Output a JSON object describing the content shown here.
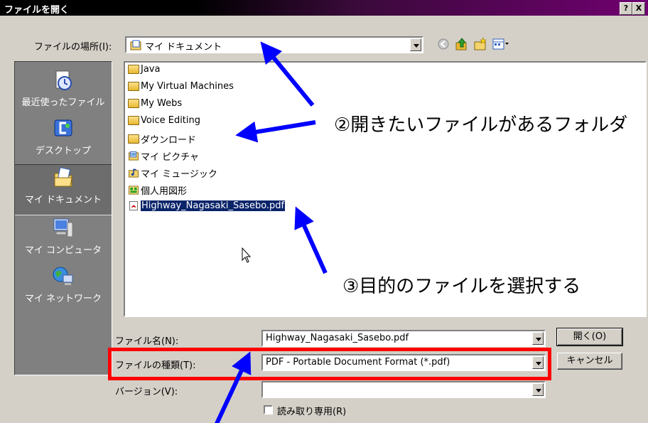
{
  "window": {
    "title": "ファイルを開く",
    "help_label": "?",
    "close_label": "X"
  },
  "lookin": {
    "label": "ファイルの場所(I):",
    "value": "マイ ドキュメント"
  },
  "toolbar_icons": [
    "back-icon",
    "up-folder-icon",
    "new-folder-icon",
    "view-menu-icon"
  ],
  "places": [
    {
      "label": "最近使ったファイル",
      "icon": "recent-files-icon"
    },
    {
      "label": "デスクトップ",
      "icon": "desktop-icon"
    },
    {
      "label": "マイ ドキュメント",
      "icon": "my-documents-icon",
      "selected": true
    },
    {
      "label": "マイ コンピュータ",
      "icon": "my-computer-icon"
    },
    {
      "label": "マイ ネットワーク",
      "icon": "my-network-icon"
    }
  ],
  "files": [
    {
      "name": "Java",
      "type": "folder"
    },
    {
      "name": "My Virtual Machines",
      "type": "folder"
    },
    {
      "name": "My Webs",
      "type": "folder"
    },
    {
      "name": "Voice Editing",
      "type": "folder"
    },
    {
      "name": "ダウンロード",
      "type": "folder"
    },
    {
      "name": "マイ ピクチャ",
      "type": "pictures"
    },
    {
      "name": "マイ ミュージック",
      "type": "music"
    },
    {
      "name": "個人用図形",
      "type": "shapes"
    },
    {
      "name": "Highway_Nagasaki_Sasebo.pdf",
      "type": "pdf",
      "selected": true
    }
  ],
  "filename": {
    "label": "ファイル名(N):",
    "value": "Highway_Nagasaki_Sasebo.pdf"
  },
  "filetype": {
    "label": "ファイルの種類(T):",
    "value": "PDF - Portable Document Format (*.pdf)"
  },
  "version": {
    "label": "バージョン(V):",
    "value": ""
  },
  "readonly": {
    "label": "読み取り専用(R)"
  },
  "buttons": {
    "open": "開く(O)",
    "cancel": "キャンセル"
  },
  "annotations": {
    "step2": "②開きたいファイルがあるフォルダ",
    "step3": "③目的のファイルを選択する"
  },
  "colors": {
    "arrow": "#0000ff",
    "highlight_box": "#ff0000",
    "selection": "#0a246a"
  }
}
